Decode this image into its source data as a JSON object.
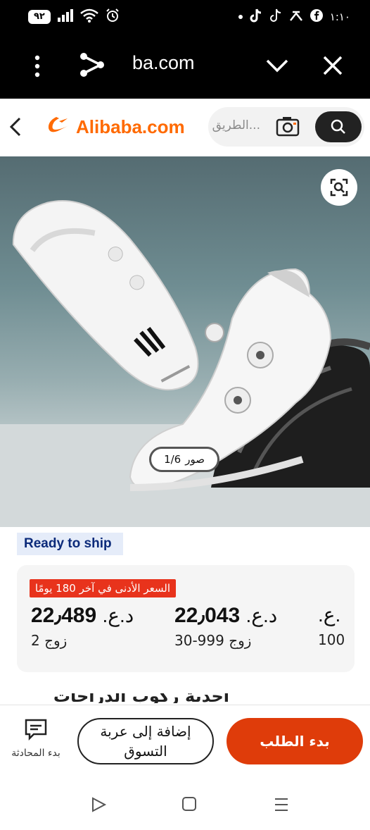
{
  "status_bar": {
    "battery": "٩٢",
    "time": "١:١٠"
  },
  "browser": {
    "url": "ba.com"
  },
  "header": {
    "logo_text": "Alibaba.com",
    "search_placeholder": "...الطريق"
  },
  "gallery": {
    "counter_label": "صور",
    "counter_value": "1/6"
  },
  "badge": {
    "ready_to_ship": "Ready to ship"
  },
  "pricing": {
    "lowest_price_badge": "السعر الأدنى في آخر 180 يومًا",
    "tiers": [
      {
        "price": "22٫489",
        "currency": "د.ع.",
        "quantity": "2 زوج"
      },
      {
        "price": "22٫043",
        "currency": "د.ع.",
        "quantity": "30-999 زوج"
      },
      {
        "price": "",
        "currency": ".ع.",
        "quantity": "100"
      }
    ]
  },
  "title_fragment": "أحذية ركوب الدراجات المقفلة",
  "actions": {
    "chat_label": "بدء المحادثة",
    "add_to_cart": "إضافة إلى عربة التسوق",
    "start_order": "بدء الطلب"
  },
  "colors": {
    "brand_orange": "#ff6a00",
    "order_button": "#df3c0a",
    "lowest_badge": "#e8331c",
    "ready_tag_bg": "#e5ecf9"
  }
}
